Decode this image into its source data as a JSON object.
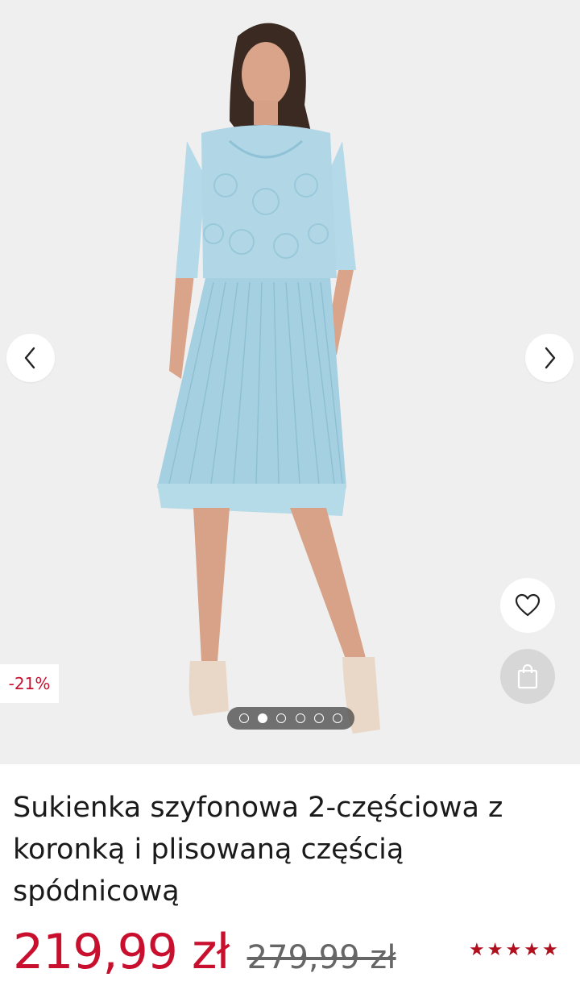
{
  "gallery": {
    "badge": "-21%",
    "image_alt": "Model w błękitnej sukience z koronką",
    "dot_count": 6,
    "active_dot": 2,
    "prev_icon": "chevron-left-icon",
    "next_icon": "chevron-right-icon",
    "wishlist_icon": "heart-icon",
    "bag_icon": "shopping-bag-icon"
  },
  "product": {
    "title_line1": "Sukienka szyfonowa 2-częściowa z",
    "title_line2": "koronką i plisowaną częścią",
    "title_line3": "spódnicową",
    "price_current": "219,99 zł",
    "price_old": "279,99 zł",
    "rating": 5,
    "rating_stars": "★★★★★"
  },
  "colors": {
    "accent": "#c8102e",
    "star": "#b0101e",
    "dress": "#a9d3e3",
    "background": "#efefef"
  }
}
